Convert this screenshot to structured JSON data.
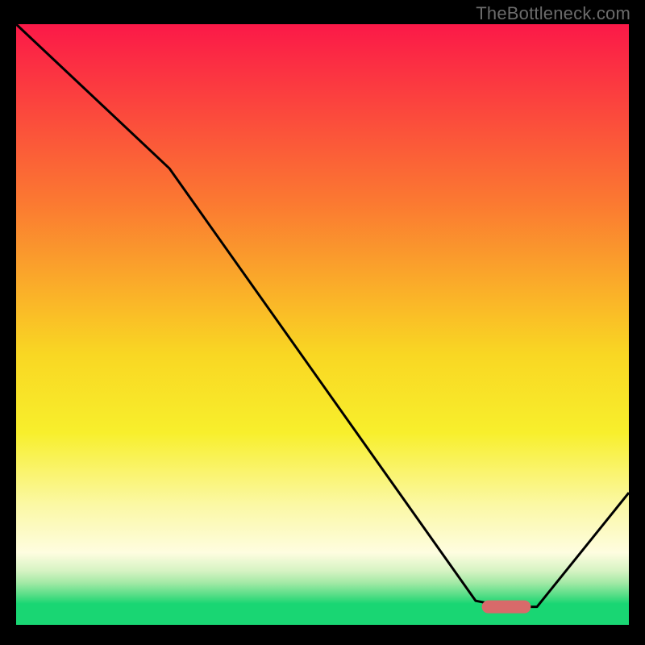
{
  "watermark": "TheBottleneck.com",
  "chart_data": {
    "type": "line",
    "title": "",
    "xlabel": "",
    "ylabel": "",
    "xlim": [
      0,
      100
    ],
    "ylim": [
      0,
      100
    ],
    "grid": false,
    "series": [
      {
        "name": "bottleneck-curve",
        "x": [
          0,
          25,
          75,
          80,
          85,
          100
        ],
        "values": [
          100,
          76,
          4,
          3,
          3,
          22
        ]
      }
    ],
    "marker": {
      "x_start": 76,
      "x_end": 84,
      "y": 3,
      "color": "#d86a6a"
    },
    "background_gradient": {
      "stops": [
        {
          "offset": 0.0,
          "color": "#fb1948"
        },
        {
          "offset": 0.3,
          "color": "#fb7a31"
        },
        {
          "offset": 0.55,
          "color": "#f9d723"
        },
        {
          "offset": 0.68,
          "color": "#f8ef2c"
        },
        {
          "offset": 0.8,
          "color": "#fbf8a4"
        },
        {
          "offset": 0.88,
          "color": "#fefde0"
        },
        {
          "offset": 0.91,
          "color": "#d6f3c3"
        },
        {
          "offset": 0.93,
          "color": "#a3e9a6"
        },
        {
          "offset": 0.95,
          "color": "#58de87"
        },
        {
          "offset": 0.965,
          "color": "#19d673"
        },
        {
          "offset": 1.0,
          "color": "#19d673"
        }
      ]
    },
    "curve_color": "#000000",
    "frame_color": "#000000"
  }
}
